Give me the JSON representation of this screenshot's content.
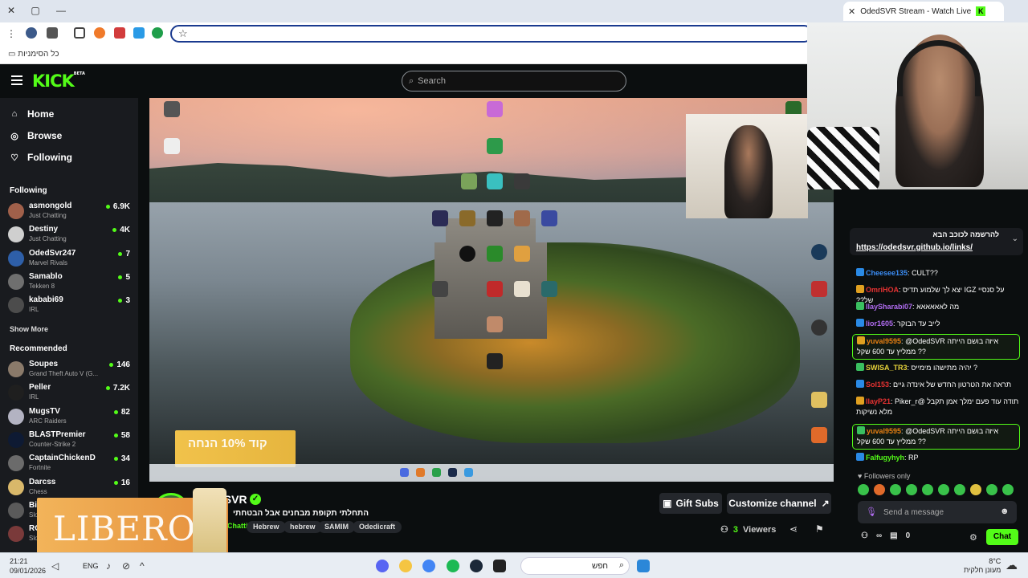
{
  "browser": {
    "tab_title": "OdedSVR Stream - Watch Live",
    "tab_favicon": "K",
    "bookmarks_folder": "כל הסימניות"
  },
  "kick": {
    "logo": "KICK",
    "logo_beta": "BETA",
    "search_placeholder": "Search",
    "nav": [
      {
        "label": "Home",
        "icon": "home-icon"
      },
      {
        "label": "Browse",
        "icon": "compass-icon"
      },
      {
        "label": "Following",
        "icon": "heart-icon"
      }
    ],
    "following_title": "Following",
    "following": [
      {
        "name": "asmongold",
        "category": "Just Chatting",
        "viewers": "6.9K",
        "color": "#a0604a"
      },
      {
        "name": "Destiny",
        "category": "Just Chatting",
        "viewers": "4K",
        "color": "#cfcfcf"
      },
      {
        "name": "OdedSvr247",
        "category": "Marvel Rivals",
        "viewers": "7",
        "color": "#2e5fa8"
      },
      {
        "name": "Samablo",
        "category": "Tekken 8",
        "viewers": "5",
        "color": "#6f6f6f"
      },
      {
        "name": "kababi69",
        "category": "IRL",
        "viewers": "3",
        "color": "#4c4c4c"
      }
    ],
    "show_more": "Show More",
    "recommended_title": "Recommended",
    "recommended": [
      {
        "name": "Soupes",
        "category": "Grand Theft Auto V (G...",
        "viewers": "146",
        "color": "#8a7a6a"
      },
      {
        "name": "Peller",
        "category": "IRL",
        "viewers": "7.2K",
        "color": "#1f1f1f"
      },
      {
        "name": "MugsTV",
        "category": "ARC Raiders",
        "viewers": "82",
        "color": "#b3b3c2"
      },
      {
        "name": "BLASTPremier",
        "category": "Counter-Strike 2",
        "viewers": "58",
        "color": "#0e1a33"
      },
      {
        "name": "CaptainChickenD",
        "category": "Fortnite",
        "viewers": "34",
        "color": "#6b6b6b"
      },
      {
        "name": "Darcss",
        "category": "Chess",
        "viewers": "16",
        "color": "#d9b86a"
      },
      {
        "name": "Big",
        "category": "Slo",
        "viewers": "",
        "color": "#5a5a5a"
      },
      {
        "name": "RO",
        "category": "Slo",
        "viewers": "",
        "color": "#7a3a3a"
      }
    ]
  },
  "video": {
    "promo_text": "קוד 10% הנחה"
  },
  "stream": {
    "streamer": "OdedSVR",
    "title": "התחלתי תקופת מבחנים אבל הבטחתי",
    "category": "Just Chatting",
    "tags": [
      "Hebrew",
      "hebrew",
      "SAMIM",
      "Odedicraft"
    ],
    "gift_label": "Gift Subs",
    "customize_label": "Customize channel",
    "viewers_value": "3",
    "viewers_label": "Viewers"
  },
  "overlay": {
    "brand": "LIBERO"
  },
  "chat": {
    "pinned_title": "להרשמה לכוכב הבא",
    "pinned_link": "https://odedsvr.github.io/links/",
    "messages": [
      {
        "user": "Cheesee135",
        "text": "CULT??",
        "color": "#3b8df5",
        "highlight": false
      },
      {
        "user": "OmriHOA",
        "text": "על סנסיי IGZ יצא לך שלמוע תדיס של??",
        "color": "#e63232",
        "highlight": false
      },
      {
        "user": "IlaySharabi07",
        "text": "מה לאאאאאא",
        "color": "#b06cf0",
        "highlight": false
      },
      {
        "user": "lior1605",
        "text": "לייב עד הבוקר",
        "color": "#b06cf0",
        "highlight": false
      },
      {
        "user": "yuval9595",
        "text": "@OdedSVR איזה בושם הייתה ממליץ עד 600 שקל ??",
        "color": "#e67f12",
        "highlight": true
      },
      {
        "user": "SWISA_TR3",
        "text": "? יהיה מתישהו מימייס",
        "color": "#e6d23a",
        "highlight": false
      },
      {
        "user": "Sol153",
        "text": "תראה את הטרטון החדש של אינדה גיים",
        "color": "#e63232",
        "highlight": false
      },
      {
        "user": "IlayP21",
        "text": "תודה עוד פעם ימלך אמן תקבל @Piker_r מלא נשיקות",
        "color": "#e63232",
        "highlight": false
      },
      {
        "user": "yuval9595",
        "text": "@OdedSVR איזה בושם הייתה ממליץ עד 600 שקל ??",
        "color": "#e67f12",
        "highlight": true
      },
      {
        "user": "Falfugyhyh",
        "text": "RP",
        "color": "#53fc18",
        "highlight": false
      }
    ],
    "followers_only": "Followers only",
    "input_placeholder": "Send a message",
    "points": "0",
    "send_label": "Chat"
  },
  "taskbar": {
    "time": "21:21",
    "date": "09/01/2026",
    "lang": "ENG",
    "search_label": "חפש",
    "weather_temp": "8°C",
    "weather_desc": "מעונן חלקית"
  }
}
